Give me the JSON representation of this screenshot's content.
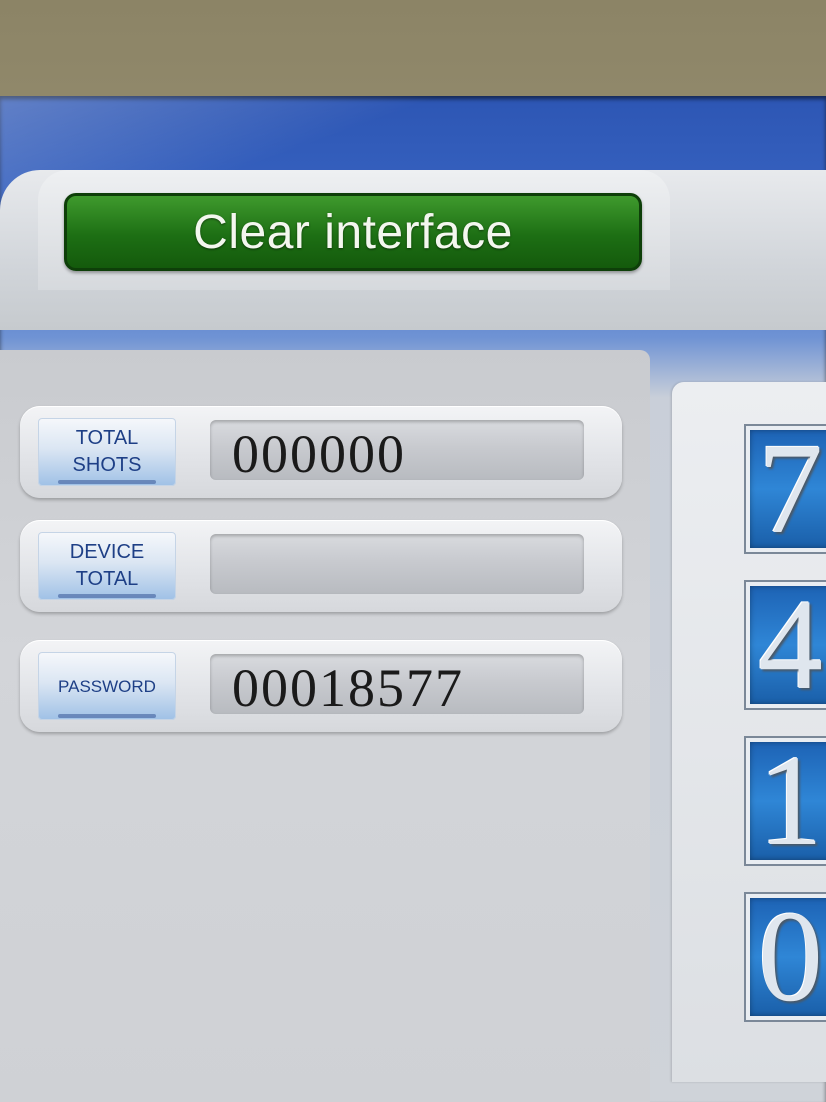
{
  "header": {
    "title": "Clear interface"
  },
  "fields": [
    {
      "label_line1": "TOTAL",
      "label_line2": "SHOTS",
      "value": "000000"
    },
    {
      "label_line1": "DEVICE",
      "label_line2": "TOTAL",
      "value": ""
    },
    {
      "label_line1": "PASSWORD",
      "label_line2": "",
      "value": "00018577"
    }
  ],
  "keypad": {
    "keys": [
      "7",
      "4",
      "1",
      "0"
    ]
  },
  "colors": {
    "title_bar": "#1d6f14",
    "label_text": "#1e3f86",
    "key_blue": "#2f86d6"
  }
}
